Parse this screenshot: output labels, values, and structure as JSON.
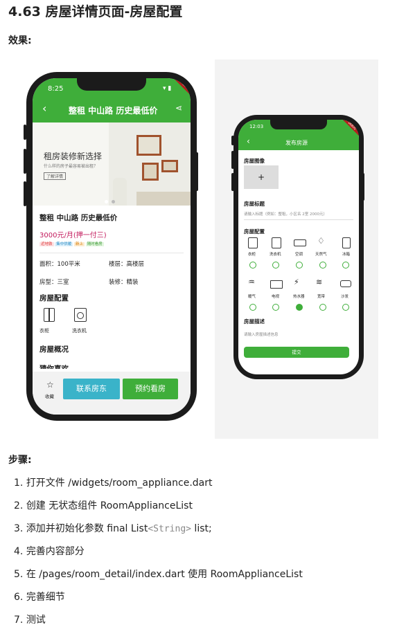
{
  "page": {
    "title": "4.63 房屋详情页面-房屋配置",
    "effect_label": "效果:",
    "steps_label": "步骤:"
  },
  "phone_left": {
    "status_time": "8:25",
    "ribbon": "DEBUG",
    "nav_title": "整租 中山路 历史最低价",
    "banner_heading": "租房装修新选择",
    "banner_sub": "什么样的房子最容易被出租？",
    "banner_button": "了解详情",
    "house_title": "整租 中山路 历史最低价",
    "price": "3000元/月(押一付三)",
    "tags": [
      "近地铁",
      "集中供暖",
      "新上",
      "随时看房"
    ],
    "info": {
      "area": "面积：100平米",
      "floor": "楼层：高楼层",
      "layout": "房型：三室",
      "decoration": "装修：精装"
    },
    "config_label": "房屋配置",
    "appliances": [
      "衣柜",
      "洗衣机"
    ],
    "overview_label": "房屋概况",
    "guess_label": "猜你喜欢",
    "favorite_label": "收藏",
    "contact_button": "联系房东",
    "appointment_button": "预约看房"
  },
  "phone_right": {
    "status_time": "12:03",
    "ribbon": "DEBUG",
    "nav_title": "发布房源",
    "image_label": "房屋图像",
    "plus": "+",
    "title_label": "房屋标题",
    "title_placeholder": "请输入标题（例如：整租，小区名 2室 2000元）",
    "config_label": "房屋配置",
    "appliances": [
      {
        "label": "衣柜",
        "icon": "wardrobe-icon",
        "selected": false
      },
      {
        "label": "洗衣机",
        "icon": "washer-icon",
        "selected": false
      },
      {
        "label": "空调",
        "icon": "ac-icon",
        "selected": false
      },
      {
        "label": "天然气",
        "icon": "gas-icon",
        "selected": false
      },
      {
        "label": "冰箱",
        "icon": "fridge-icon",
        "selected": false
      },
      {
        "label": "暖气",
        "icon": "heating-icon",
        "selected": false
      },
      {
        "label": "电视",
        "icon": "tv-icon",
        "selected": false
      },
      {
        "label": "热水器",
        "icon": "water-heater-icon",
        "selected": true
      },
      {
        "label": "宽带",
        "icon": "wifi-icon",
        "selected": false
      },
      {
        "label": "沙发",
        "icon": "sofa-icon",
        "selected": false
      }
    ],
    "desc_label": "房屋描述",
    "desc_placeholder": "请输入房屋描述信息",
    "submit_button": "提交"
  },
  "steps": [
    {
      "num": "1.",
      "text": "打开文件 /widgets/room_appliance.dart"
    },
    {
      "num": "2.",
      "text": "创建 无状态组件 RoomApplianceList"
    },
    {
      "num": "3.",
      "pre": "添加并初始化参数 final List",
      "code": "<String>",
      "post": " list;"
    },
    {
      "num": "4.",
      "text": "完善内容部分"
    },
    {
      "num": "5.",
      "text": "在 /pages/room_detail/index.dart 使用 RoomApplianceList"
    },
    {
      "num": "6.",
      "text": "完善细节"
    },
    {
      "num": "7.",
      "text": "测试"
    }
  ],
  "colors": {
    "primary_green": "#3fae3a",
    "contact_blue": "#3ab3c9",
    "price_red": "#c2185b"
  }
}
